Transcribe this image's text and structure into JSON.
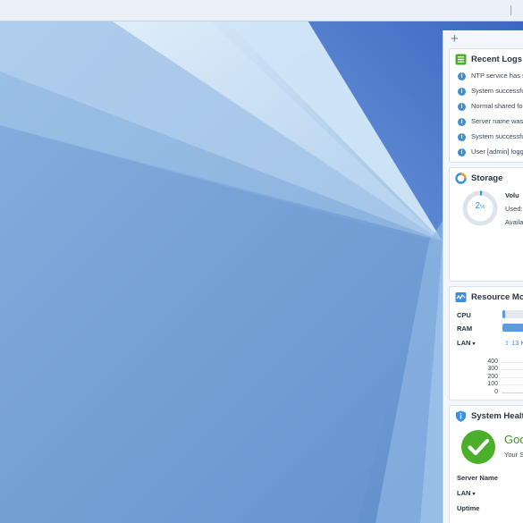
{
  "panel": {
    "add_label": "+",
    "recent_logs": {
      "title": "Recent Logs",
      "items": [
        "NTP service has s",
        "System successfu",
        "Normal shared fo",
        "Server name was",
        "System successfu",
        "User [admin] logg"
      ]
    },
    "storage": {
      "title": "Storage",
      "percent": "2",
      "percent_unit": "%",
      "usage_fraction": 0.02,
      "volume_label": "Volu",
      "used_label": "Used:",
      "available_label": "Availa"
    },
    "resource_monitor": {
      "title": "Resource Mon",
      "cpu_label": "CPU",
      "cpu_fraction": 0.08,
      "ram_label": "RAM",
      "ram_fraction": 0.95,
      "lan_label": "LAN",
      "lan_value": "13 K",
      "chart_ticks": [
        "400",
        "300",
        "200",
        "100",
        "0"
      ]
    },
    "system_health": {
      "title": "System Healt",
      "status": "Goo",
      "status_sub": "Your S",
      "server_name_label": "Server Name",
      "lan_label": "LAN",
      "uptime_label": "Uptime"
    }
  },
  "colors": {
    "accent": "#3d8fd8",
    "healthy": "#4caf2a",
    "healthy_text": "#3a9a1e"
  }
}
